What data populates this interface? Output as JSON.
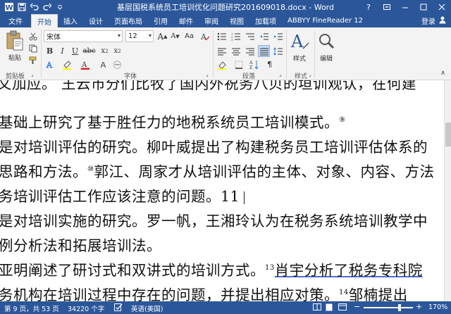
{
  "window": {
    "title": "基层国税系统员工培训优化问题研究201609018.docx - Word"
  },
  "qat": {
    "save_icon": "save-icon",
    "undo_icon": "undo-icon",
    "redo_icon": "redo-icon"
  },
  "tabs": [
    {
      "label": "文件"
    },
    {
      "label": "开始"
    },
    {
      "label": "插入"
    },
    {
      "label": "设计"
    },
    {
      "label": "页面布局"
    },
    {
      "label": "引用"
    },
    {
      "label": "邮件"
    },
    {
      "label": "审阅"
    },
    {
      "label": "视图"
    },
    {
      "label": "加载项"
    },
    {
      "label": "ABBYY FineReader 12"
    }
  ],
  "account": {
    "signin_label": "登录"
  },
  "ribbon": {
    "paste_label": "粘贴",
    "font_name": "宋体",
    "font_size": "12",
    "styles_label": "样式",
    "editing_label": "编辑",
    "group_clipboard": "剪贴板",
    "group_font": "字体",
    "group_paragraph": "段落",
    "group_styles": "样式",
    "colors": {
      "highlight": "#ffff00",
      "font_color": "#e02020",
      "accent": "#2b579a"
    }
  },
  "document": {
    "lines": [
      {
        "text": "文加应。  王云市分们比牧了国内外祝务八贝的垣训观认，在何建"
      },
      {
        "text": "基础上研究了基于胜任力的地税系统员工培训模式。",
        "sup": "⑨"
      },
      {
        "text": "是对培训评估的研究。柳叶威提出了构建税务员工培训评估体系的"
      },
      {
        "text": "思路和方法。",
        "sup": "⑩",
        "text2": "郭江、周家才从培训评估的主体、对象、内容、方法"
      },
      {
        "text": "务培训评估工作应该注意的问题。11"
      },
      {
        "text": "是对培训实施的研究。罗一帆，王湘玲认为在税务系统培训教学中"
      },
      {
        "text": "例分析法和拓展培训法。"
      },
      {
        "text": "亚明阐述了研讨式和双讲式的培训方式。",
        "sup": "13",
        "text2": "肖宇分析了税务专科院"
      },
      {
        "text": "务机构在培训过程中存在的问题，并提出相应对策。",
        "sup": "14",
        "text2": "邹楠提出"
      }
    ]
  },
  "status": {
    "page": "第 9 页，共 53 页",
    "words": "34220 个字",
    "language": "英语(美国)",
    "zoom": "170%",
    "zoom_minus": "−",
    "zoom_plus": "+"
  }
}
